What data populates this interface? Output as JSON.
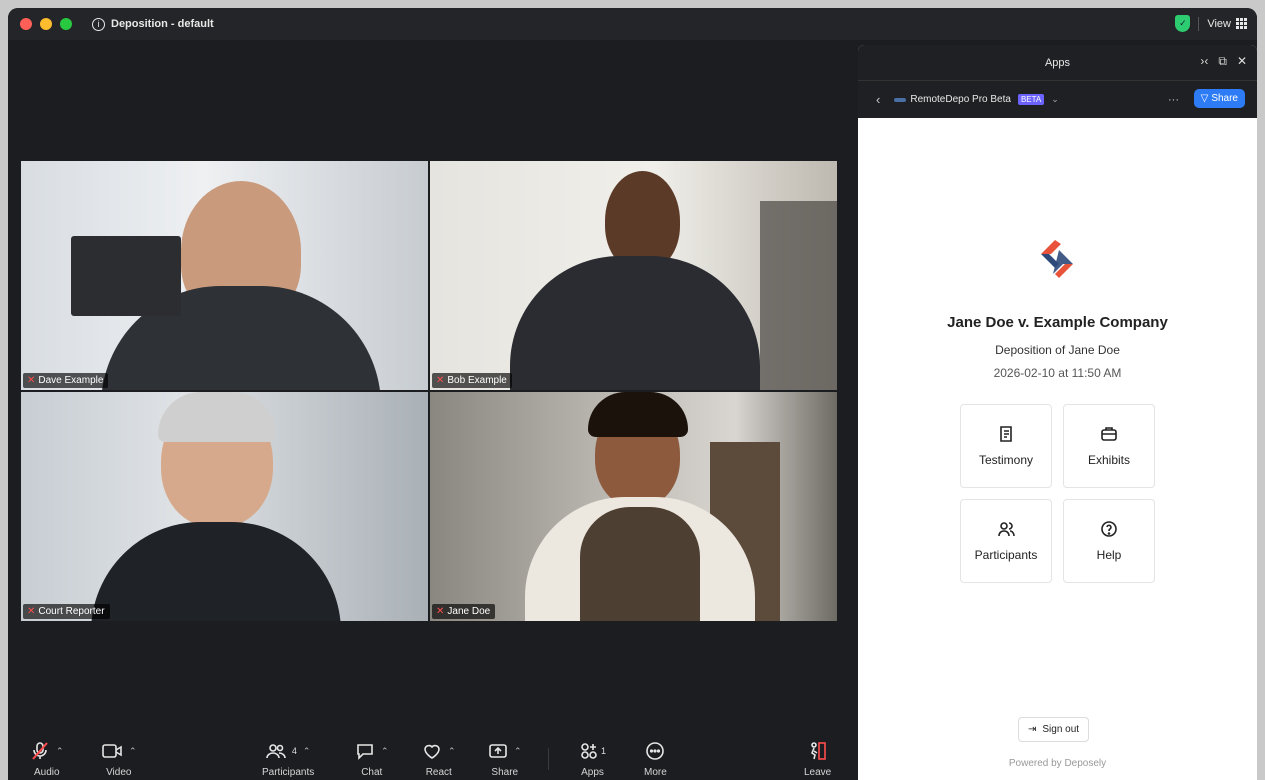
{
  "window": {
    "title": "Deposition - default",
    "view_label": "View"
  },
  "participants": [
    {
      "name": "Dave Example"
    },
    {
      "name": "Bob Example"
    },
    {
      "name": "Court Reporter"
    },
    {
      "name": "Jane Doe"
    }
  ],
  "toolbar": {
    "audio": "Audio",
    "video": "Video",
    "participants": "Participants",
    "participants_count": "4",
    "chat": "Chat",
    "react": "React",
    "share": "Share",
    "apps": "Apps",
    "apps_count": "1",
    "more": "More",
    "leave": "Leave"
  },
  "panel": {
    "header_title": "Apps",
    "app_name": "RemoteDepo Pro Beta",
    "beta_badge": "BETA",
    "share_label": "Share",
    "case_title": "Jane Doe v. Example Company",
    "case_subtitle": "Deposition of Jane Doe",
    "case_datetime": "2026-02-10 at 11:50 AM",
    "cards": {
      "testimony": "Testimony",
      "exhibits": "Exhibits",
      "participants": "Participants",
      "help": "Help"
    },
    "sign_out": "Sign out",
    "powered_by": "Powered by Deposely"
  },
  "colors": {
    "accent_blue": "#2d7cf6",
    "beta_purple": "#6c63ff",
    "leave_red": "#ff4d4d",
    "logo_red": "#e8533a",
    "logo_navy": "#2d4a7a"
  }
}
